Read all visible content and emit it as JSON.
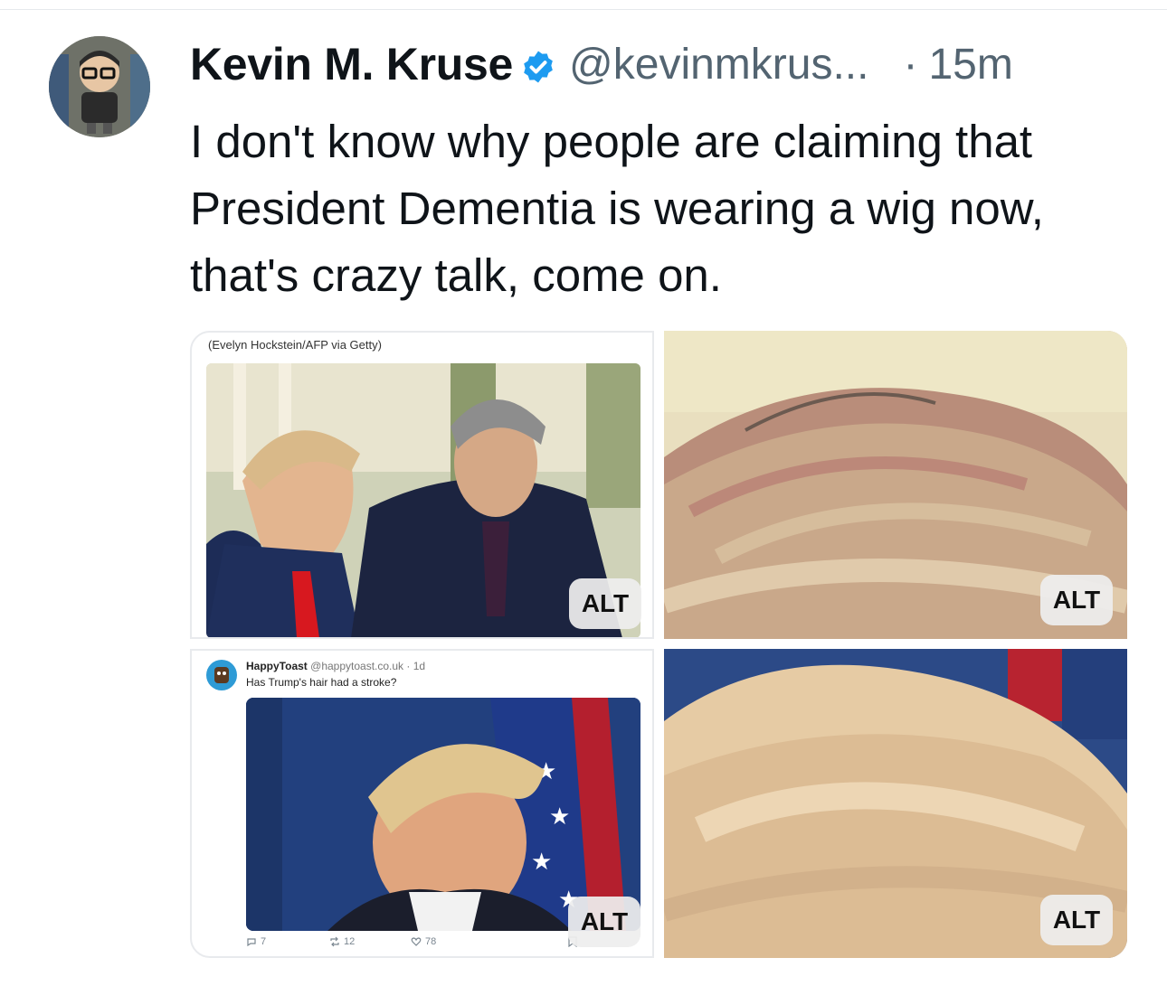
{
  "tweet": {
    "author_name": "Kevin M. Kruse",
    "handle": "@kevinmkrus...",
    "separator": "·",
    "time": "15m",
    "text": "I don't know why people are claiming that President Dementia is wearing a wig now, that's crazy talk, come on.",
    "verified_icon": "verified-badge-icon",
    "accent_color": "#1d9bf0"
  },
  "media": {
    "top_left": {
      "caption": "(Evelyn Hockstein/AFP via Getty)",
      "alt_label": "ALT"
    },
    "top_right": {
      "alt_label": "ALT"
    },
    "bottom_left": {
      "embedded_post": {
        "author": "HappyToast",
        "handle_time": "@happytoast.co.uk · 1d",
        "text": "Has Trump's hair had a stroke?",
        "replies": "7",
        "reposts": "12",
        "likes": "78"
      },
      "alt_label": "ALT"
    },
    "bottom_right": {
      "alt_label": "ALT"
    }
  }
}
